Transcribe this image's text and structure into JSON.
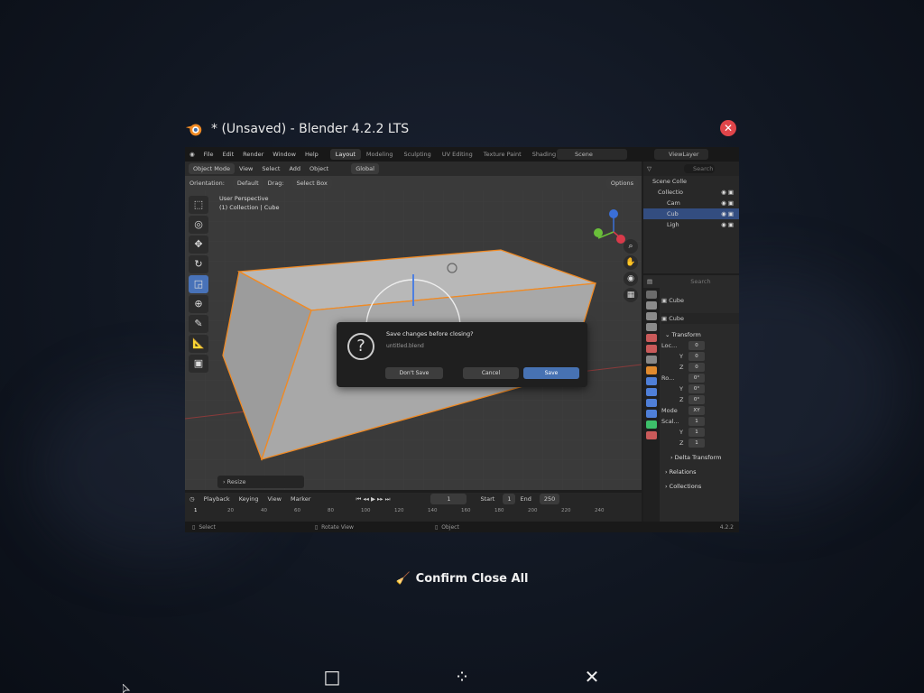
{
  "window": {
    "title": "* (Unsaved) - Blender 4.2.2 LTS",
    "close_label": "✕"
  },
  "blender": {
    "menu": [
      "File",
      "Edit",
      "Render",
      "Window",
      "Help"
    ],
    "workspaces": [
      "Layout",
      "Modeling",
      "Sculpting",
      "UV Editing",
      "Texture Paint",
      "Shading"
    ],
    "active_workspace": "Layout",
    "scene": "Scene",
    "view_layer": "ViewLayer",
    "viewport": {
      "mode": "Object Mode",
      "menus": [
        "View",
        "Select",
        "Add",
        "Object"
      ],
      "transform_orientation": "Global",
      "orientation_label": "Orientation:",
      "orientation_value": "Default",
      "drag_label": "Drag:",
      "drag_value": "Select Box",
      "options": "Options",
      "info_line1": "User Perspective",
      "info_line2": "(1) Collection | Cube",
      "resize_panel": "Resize"
    },
    "dialog": {
      "icon": "?",
      "title": "Save changes before closing?",
      "filename": "untitled.blend",
      "dont_save": "Don't Save",
      "cancel": "Cancel",
      "save": "Save"
    },
    "outliner": {
      "search_placeholder": "Search",
      "rows": [
        {
          "label": "Scene Colle",
          "selected": false
        },
        {
          "label": "Collectio",
          "selected": false
        },
        {
          "label": "Cam",
          "selected": false
        },
        {
          "label": "Cub",
          "selected": true
        },
        {
          "label": "Ligh",
          "selected": false
        }
      ]
    },
    "properties": {
      "search_placeholder": "Search",
      "object_name": "Cube",
      "data_name": "Cube",
      "transform_header": "Transform",
      "location_label": "Loc...",
      "location": [
        "0",
        "0",
        "0"
      ],
      "rotation_label": "Ro...",
      "rotation": [
        "0°",
        "0°",
        "0°"
      ],
      "mode_label": "Mode",
      "mode_value": "XY",
      "scale_label": "Scal...",
      "scale": [
        "1",
        "1",
        "1"
      ],
      "axis_y": "Y",
      "axis_z": "Z",
      "delta_transform": "Delta Transform",
      "relations": "Relations",
      "collections": "Collections"
    },
    "timeline": {
      "menus": [
        "Playback",
        "Keying",
        "View",
        "Marker"
      ],
      "current_frame": "1",
      "start_label": "Start",
      "start": "1",
      "end_label": "End",
      "end": "250",
      "ruler": [
        "1",
        "20",
        "40",
        "60",
        "80",
        "100",
        "120",
        "140",
        "160",
        "180",
        "200",
        "220",
        "240"
      ]
    },
    "status": {
      "select": "Select",
      "rotate_view": "Rotate View",
      "object": "Object",
      "version": "4.2.2"
    }
  },
  "caption": {
    "label": "Confirm Close All"
  },
  "taskbar": {
    "maximize_icon": "□",
    "move_icon": "⁘",
    "close_icon": "✕"
  }
}
